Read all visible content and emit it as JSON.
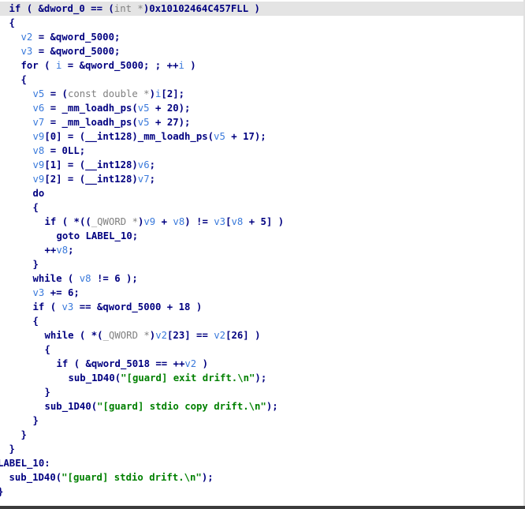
{
  "colors": {
    "keyword": "#000080",
    "variable": "#3979db",
    "type": "#808080",
    "string": "#008000",
    "highlight_line": "#e4e4e4",
    "background": "#ffffff"
  },
  "editor": {
    "highlighted_line": 0,
    "lines": [
      {
        "indent": 1,
        "tokens": [
          [
            "kw",
            "if"
          ],
          [
            "punc",
            " ( "
          ],
          [
            "name",
            "&dword_0"
          ],
          [
            "op",
            " == "
          ],
          [
            "punc",
            "("
          ],
          [
            "type",
            "int *"
          ],
          [
            "punc",
            ")"
          ],
          [
            "num",
            "0x10102464C457FLL"
          ],
          [
            "punc",
            " )"
          ]
        ]
      },
      {
        "indent": 1,
        "tokens": [
          [
            "punc",
            "{"
          ]
        ]
      },
      {
        "indent": 3,
        "tokens": [
          [
            "var",
            "v2"
          ],
          [
            "op",
            " = "
          ],
          [
            "name",
            "&qword_5000"
          ],
          [
            "punc",
            ";"
          ]
        ]
      },
      {
        "indent": 3,
        "tokens": [
          [
            "var",
            "v3"
          ],
          [
            "op",
            " = "
          ],
          [
            "name",
            "&qword_5000"
          ],
          [
            "punc",
            ";"
          ]
        ]
      },
      {
        "indent": 3,
        "tokens": [
          [
            "kw",
            "for"
          ],
          [
            "punc",
            " ( "
          ],
          [
            "var",
            "i"
          ],
          [
            "op",
            " = "
          ],
          [
            "name",
            "&qword_5000"
          ],
          [
            "punc",
            "; ; "
          ],
          [
            "op",
            "++"
          ],
          [
            "var",
            "i"
          ],
          [
            "punc",
            " )"
          ]
        ]
      },
      {
        "indent": 3,
        "tokens": [
          [
            "punc",
            "{"
          ]
        ]
      },
      {
        "indent": 5,
        "tokens": [
          [
            "var",
            "v5"
          ],
          [
            "op",
            " = "
          ],
          [
            "punc",
            "("
          ],
          [
            "type",
            "const double *"
          ],
          [
            "punc",
            ")"
          ],
          [
            "var",
            "i"
          ],
          [
            "punc",
            "["
          ],
          [
            "num",
            "2"
          ],
          [
            "punc",
            "];"
          ]
        ]
      },
      {
        "indent": 5,
        "tokens": [
          [
            "var",
            "v6"
          ],
          [
            "op",
            " = "
          ],
          [
            "call",
            "_mm_loadh_ps"
          ],
          [
            "punc",
            "("
          ],
          [
            "var",
            "v5"
          ],
          [
            "op",
            " + "
          ],
          [
            "num",
            "20"
          ],
          [
            "punc",
            ");"
          ]
        ]
      },
      {
        "indent": 5,
        "tokens": [
          [
            "var",
            "v7"
          ],
          [
            "op",
            " = "
          ],
          [
            "call",
            "_mm_loadh_ps"
          ],
          [
            "punc",
            "("
          ],
          [
            "var",
            "v5"
          ],
          [
            "op",
            " + "
          ],
          [
            "num",
            "27"
          ],
          [
            "punc",
            ");"
          ]
        ]
      },
      {
        "indent": 5,
        "tokens": [
          [
            "var",
            "v9"
          ],
          [
            "punc",
            "["
          ],
          [
            "num",
            "0"
          ],
          [
            "punc",
            "]"
          ],
          [
            "op",
            " = "
          ],
          [
            "punc",
            "("
          ],
          [
            "name",
            "__int128"
          ],
          [
            "punc",
            ")"
          ],
          [
            "call",
            "_mm_loadh_ps"
          ],
          [
            "punc",
            "("
          ],
          [
            "var",
            "v5"
          ],
          [
            "op",
            " + "
          ],
          [
            "num",
            "17"
          ],
          [
            "punc",
            ");"
          ]
        ]
      },
      {
        "indent": 5,
        "tokens": [
          [
            "var",
            "v8"
          ],
          [
            "op",
            " = "
          ],
          [
            "num",
            "0LL"
          ],
          [
            "punc",
            ";"
          ]
        ]
      },
      {
        "indent": 5,
        "tokens": [
          [
            "var",
            "v9"
          ],
          [
            "punc",
            "["
          ],
          [
            "num",
            "1"
          ],
          [
            "punc",
            "]"
          ],
          [
            "op",
            " = "
          ],
          [
            "punc",
            "("
          ],
          [
            "name",
            "__int128"
          ],
          [
            "punc",
            ")"
          ],
          [
            "var",
            "v6"
          ],
          [
            "punc",
            ";"
          ]
        ]
      },
      {
        "indent": 5,
        "tokens": [
          [
            "var",
            "v9"
          ],
          [
            "punc",
            "["
          ],
          [
            "num",
            "2"
          ],
          [
            "punc",
            "]"
          ],
          [
            "op",
            " = "
          ],
          [
            "punc",
            "("
          ],
          [
            "name",
            "__int128"
          ],
          [
            "punc",
            ")"
          ],
          [
            "var",
            "v7"
          ],
          [
            "punc",
            ";"
          ]
        ]
      },
      {
        "indent": 5,
        "tokens": [
          [
            "kw",
            "do"
          ]
        ]
      },
      {
        "indent": 5,
        "tokens": [
          [
            "punc",
            "{"
          ]
        ]
      },
      {
        "indent": 7,
        "tokens": [
          [
            "kw",
            "if"
          ],
          [
            "punc",
            " ( "
          ],
          [
            "op",
            "*"
          ],
          [
            "punc",
            "(("
          ],
          [
            "type",
            "_QWORD *"
          ],
          [
            "punc",
            ")"
          ],
          [
            "var",
            "v9"
          ],
          [
            "op",
            " + "
          ],
          [
            "var",
            "v8"
          ],
          [
            "punc",
            ")"
          ],
          [
            "op",
            " != "
          ],
          [
            "var",
            "v3"
          ],
          [
            "punc",
            "["
          ],
          [
            "var",
            "v8"
          ],
          [
            "op",
            " + "
          ],
          [
            "num",
            "5"
          ],
          [
            "punc",
            "] )"
          ]
        ]
      },
      {
        "indent": 9,
        "tokens": [
          [
            "kw",
            "goto"
          ],
          [
            "punc",
            " "
          ],
          [
            "label",
            "LABEL_10"
          ],
          [
            "punc",
            ";"
          ]
        ]
      },
      {
        "indent": 7,
        "tokens": [
          [
            "op",
            "++"
          ],
          [
            "var",
            "v8"
          ],
          [
            "punc",
            ";"
          ]
        ]
      },
      {
        "indent": 5,
        "tokens": [
          [
            "punc",
            "}"
          ]
        ]
      },
      {
        "indent": 5,
        "tokens": [
          [
            "kw",
            "while"
          ],
          [
            "punc",
            " ( "
          ],
          [
            "var",
            "v8"
          ],
          [
            "op",
            " != "
          ],
          [
            "num",
            "6"
          ],
          [
            "punc",
            " );"
          ]
        ]
      },
      {
        "indent": 5,
        "tokens": [
          [
            "var",
            "v3"
          ],
          [
            "op",
            " += "
          ],
          [
            "num",
            "6"
          ],
          [
            "punc",
            ";"
          ]
        ]
      },
      {
        "indent": 5,
        "tokens": [
          [
            "kw",
            "if"
          ],
          [
            "punc",
            " ( "
          ],
          [
            "var",
            "v3"
          ],
          [
            "op",
            " == "
          ],
          [
            "name",
            "&qword_5000"
          ],
          [
            "op",
            " + "
          ],
          [
            "num",
            "18"
          ],
          [
            "punc",
            " )"
          ]
        ]
      },
      {
        "indent": 5,
        "tokens": [
          [
            "punc",
            "{"
          ]
        ]
      },
      {
        "indent": 7,
        "tokens": [
          [
            "kw",
            "while"
          ],
          [
            "punc",
            " ( "
          ],
          [
            "op",
            "*"
          ],
          [
            "punc",
            "("
          ],
          [
            "type",
            "_QWORD *"
          ],
          [
            "punc",
            ")"
          ],
          [
            "var",
            "v2"
          ],
          [
            "punc",
            "["
          ],
          [
            "num",
            "23"
          ],
          [
            "punc",
            "]"
          ],
          [
            "op",
            " == "
          ],
          [
            "var",
            "v2"
          ],
          [
            "punc",
            "["
          ],
          [
            "num",
            "26"
          ],
          [
            "punc",
            "] )"
          ]
        ]
      },
      {
        "indent": 7,
        "tokens": [
          [
            "punc",
            "{"
          ]
        ]
      },
      {
        "indent": 9,
        "tokens": [
          [
            "kw",
            "if"
          ],
          [
            "punc",
            " ( "
          ],
          [
            "name",
            "&qword_5018"
          ],
          [
            "op",
            " == ++"
          ],
          [
            "var",
            "v2"
          ],
          [
            "punc",
            " )"
          ]
        ]
      },
      {
        "indent": 11,
        "tokens": [
          [
            "call",
            "sub_1D40"
          ],
          [
            "punc",
            "("
          ],
          [
            "str",
            "\"[guard] exit drift.\\n\""
          ],
          [
            "punc",
            ");"
          ]
        ]
      },
      {
        "indent": 7,
        "tokens": [
          [
            "punc",
            "}"
          ]
        ]
      },
      {
        "indent": 7,
        "tokens": [
          [
            "call",
            "sub_1D40"
          ],
          [
            "punc",
            "("
          ],
          [
            "str",
            "\"[guard] stdio copy drift.\\n\""
          ],
          [
            "punc",
            ");"
          ]
        ]
      },
      {
        "indent": 5,
        "tokens": [
          [
            "punc",
            "}"
          ]
        ]
      },
      {
        "indent": 3,
        "tokens": [
          [
            "punc",
            "}"
          ]
        ]
      },
      {
        "indent": 1,
        "tokens": [
          [
            "punc",
            "}"
          ]
        ]
      },
      {
        "indent": -1,
        "tokens": [
          [
            "label",
            "LABEL_10"
          ],
          [
            "punc",
            ":"
          ]
        ]
      },
      {
        "indent": 1,
        "tokens": [
          [
            "call",
            "sub_1D40"
          ],
          [
            "punc",
            "("
          ],
          [
            "str",
            "\"[guard] stdio drift.\\n\""
          ],
          [
            "punc",
            ");"
          ]
        ]
      },
      {
        "indent": -1,
        "tokens": [
          [
            "punc",
            "}"
          ]
        ]
      }
    ]
  }
}
